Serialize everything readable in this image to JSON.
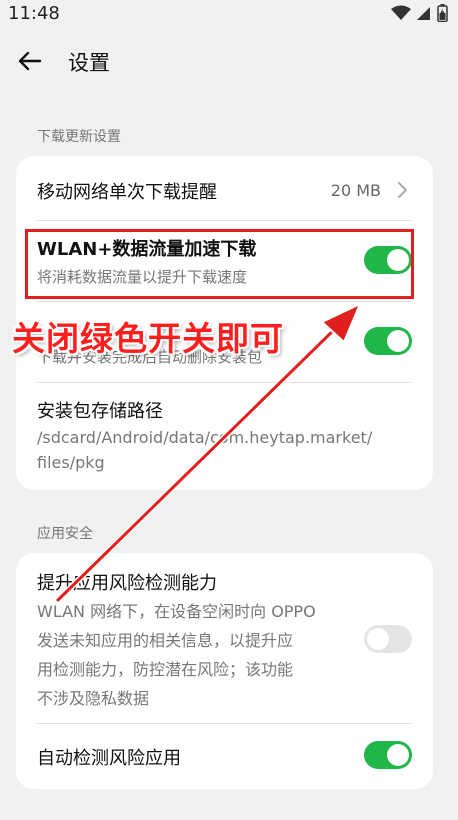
{
  "status_bar": {
    "time": "11:48",
    "icons": [
      "wifi-icon",
      "signal-icon",
      "battery-icon"
    ]
  },
  "header": {
    "title": "设置",
    "back_icon": "arrow-left-icon"
  },
  "sections": {
    "download": {
      "label": "下载更新设置",
      "mobile_reminder": {
        "title": "移动网络单次下载提醒",
        "value": "20 MB",
        "icon": "chevron-right-icon"
      },
      "wlan_boost": {
        "title": "WLAN+数据流量加速下载",
        "subtitle": "将消耗数据流量以提升下载速度",
        "enabled": true
      },
      "auto_delete": {
        "subtitle": "下载并安装完成后自动删除安装包",
        "enabled": true
      },
      "storage_path": {
        "title": "安装包存储路径",
        "path_line1": "/sdcard/Android/data/com.heytap.market/",
        "path_line2": "files/pkg"
      }
    },
    "security": {
      "label": "应用安全",
      "risk_detect": {
        "title": "提升应用风险检测能力",
        "desc_line1": "WLAN 网络下，在设备空闲时向 OPPO",
        "desc_line2": "发送未知应用的相关信息，以提升应",
        "desc_line3": "用检测能力，防控潜在风险；该功能",
        "desc_line4": "不涉及隐私数据",
        "enabled": false
      },
      "auto_check": {
        "title": "自动检测风险应用",
        "enabled": true
      }
    }
  },
  "annotation": {
    "text": "关闭绿色开关即可",
    "color": "#ff1e1e"
  },
  "colors": {
    "toggle_on": "#20b64a",
    "toggle_off": "#e4e4e4",
    "background": "#f1f1f1",
    "card": "#ffffff",
    "annotation_red": "#e0201e"
  }
}
